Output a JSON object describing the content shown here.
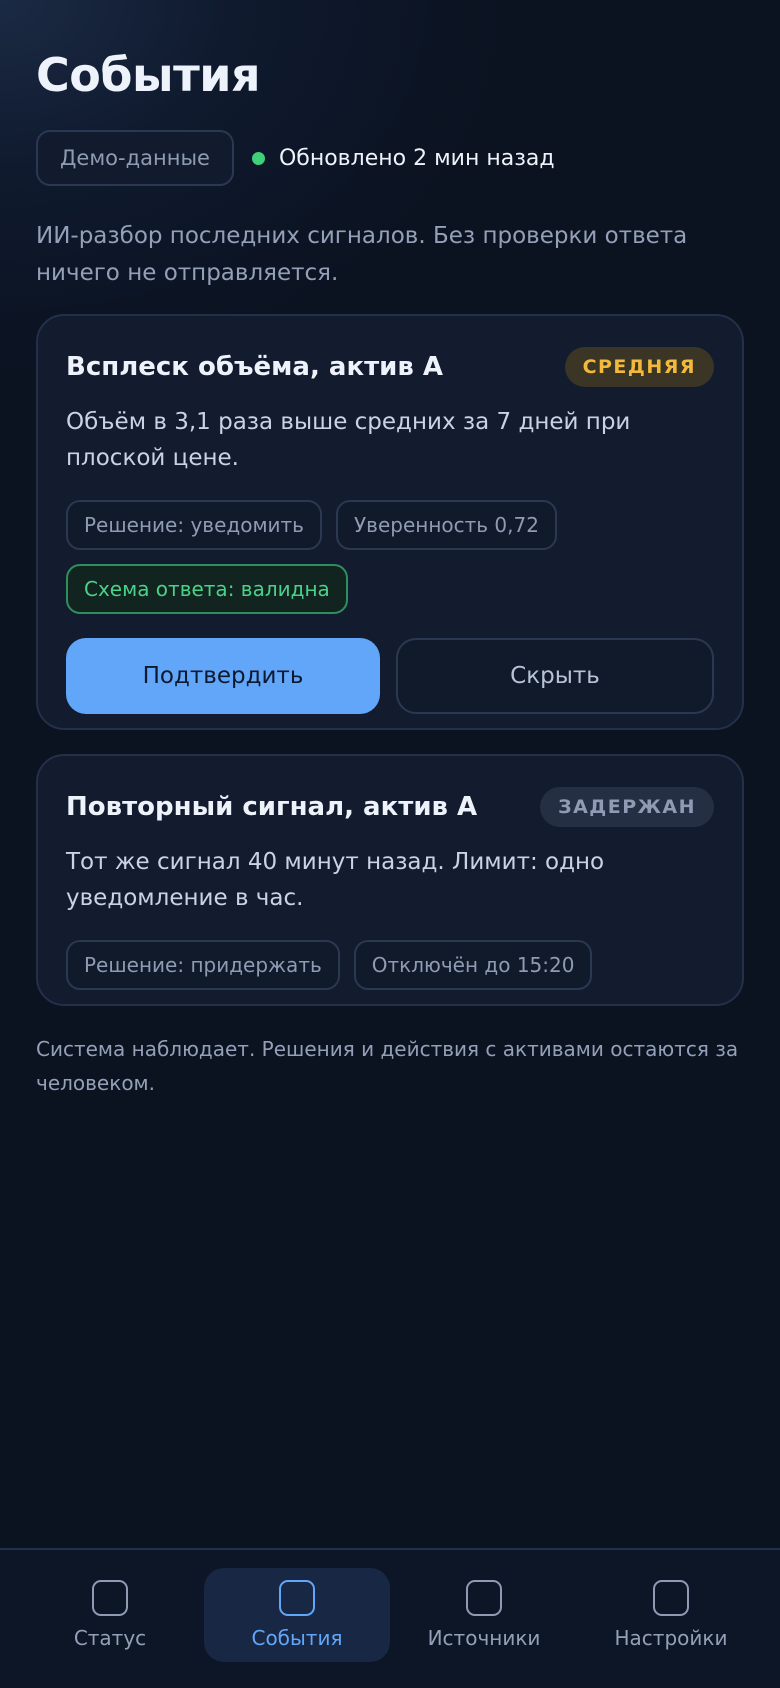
{
  "header": {
    "title": "События",
    "demo_label": "Демо-данные",
    "updated_text": "Обновлено 2 мин назад",
    "description": "ИИ-разбор последних сигналов. Без проверки ответа ничего не отправляется."
  },
  "events": [
    {
      "title": "Всплеск объёма, актив А",
      "badge": "СРЕДНЯЯ",
      "text": "Объём в 3,1 раза выше средних за 7 дней при плоской цене.",
      "chips": [
        "Решение: уведомить",
        "Уверенность 0,72"
      ],
      "schema_chip": "Схема ответа: валидна",
      "confirm_label": "Подтвердить",
      "hide_label": "Скрыть"
    },
    {
      "title": "Повторный сигнал, актив А",
      "badge": "ЗАДЕРЖАН",
      "text": "Тот же сигнал 40 минут назад. Лимит: одно уведомление в час.",
      "chips": [
        "Решение: придержать",
        "Отключён до 15:20"
      ]
    }
  ],
  "footnote": "Система наблюдает. Решения и действия с активами остаются за человеком.",
  "nav": {
    "items": [
      {
        "label": "Статус",
        "icon": "status-icon"
      },
      {
        "label": "События",
        "icon": "events-icon",
        "active": true
      },
      {
        "label": "Источники",
        "icon": "sources-icon"
      },
      {
        "label": "Настройки",
        "icon": "settings-icon"
      }
    ]
  },
  "colors": {
    "background": "#0b1220",
    "accent": "#62a6fa",
    "success": "#3fd07a",
    "warning": "#f2b93b"
  }
}
